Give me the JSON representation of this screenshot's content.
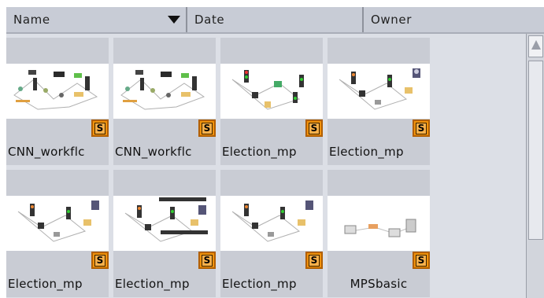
{
  "columns": {
    "name": "Name",
    "date": "Date",
    "owner": "Owner"
  },
  "badge_letter": "S",
  "files": [
    {
      "name": "CNN_workflc",
      "thumb": "cnn-workflow-diagram"
    },
    {
      "name": "CNN_workflc",
      "thumb": "cnn-workflow-diagram"
    },
    {
      "name": "Election_mp",
      "thumb": "election-diagram"
    },
    {
      "name": "Election_mp",
      "thumb": "election-diagram"
    },
    {
      "name": "Election_mp",
      "thumb": "election-diagram"
    },
    {
      "name": "Election_mp",
      "thumb": "election-diagram-banner"
    },
    {
      "name": "Election_mp",
      "thumb": "election-diagram"
    },
    {
      "name": "MPSbasic",
      "thumb": "mps-basic-diagram"
    }
  ],
  "colors": {
    "badge": "#f0920c",
    "header": "#c8ccd6",
    "grid_background": "#dcdfe6"
  }
}
